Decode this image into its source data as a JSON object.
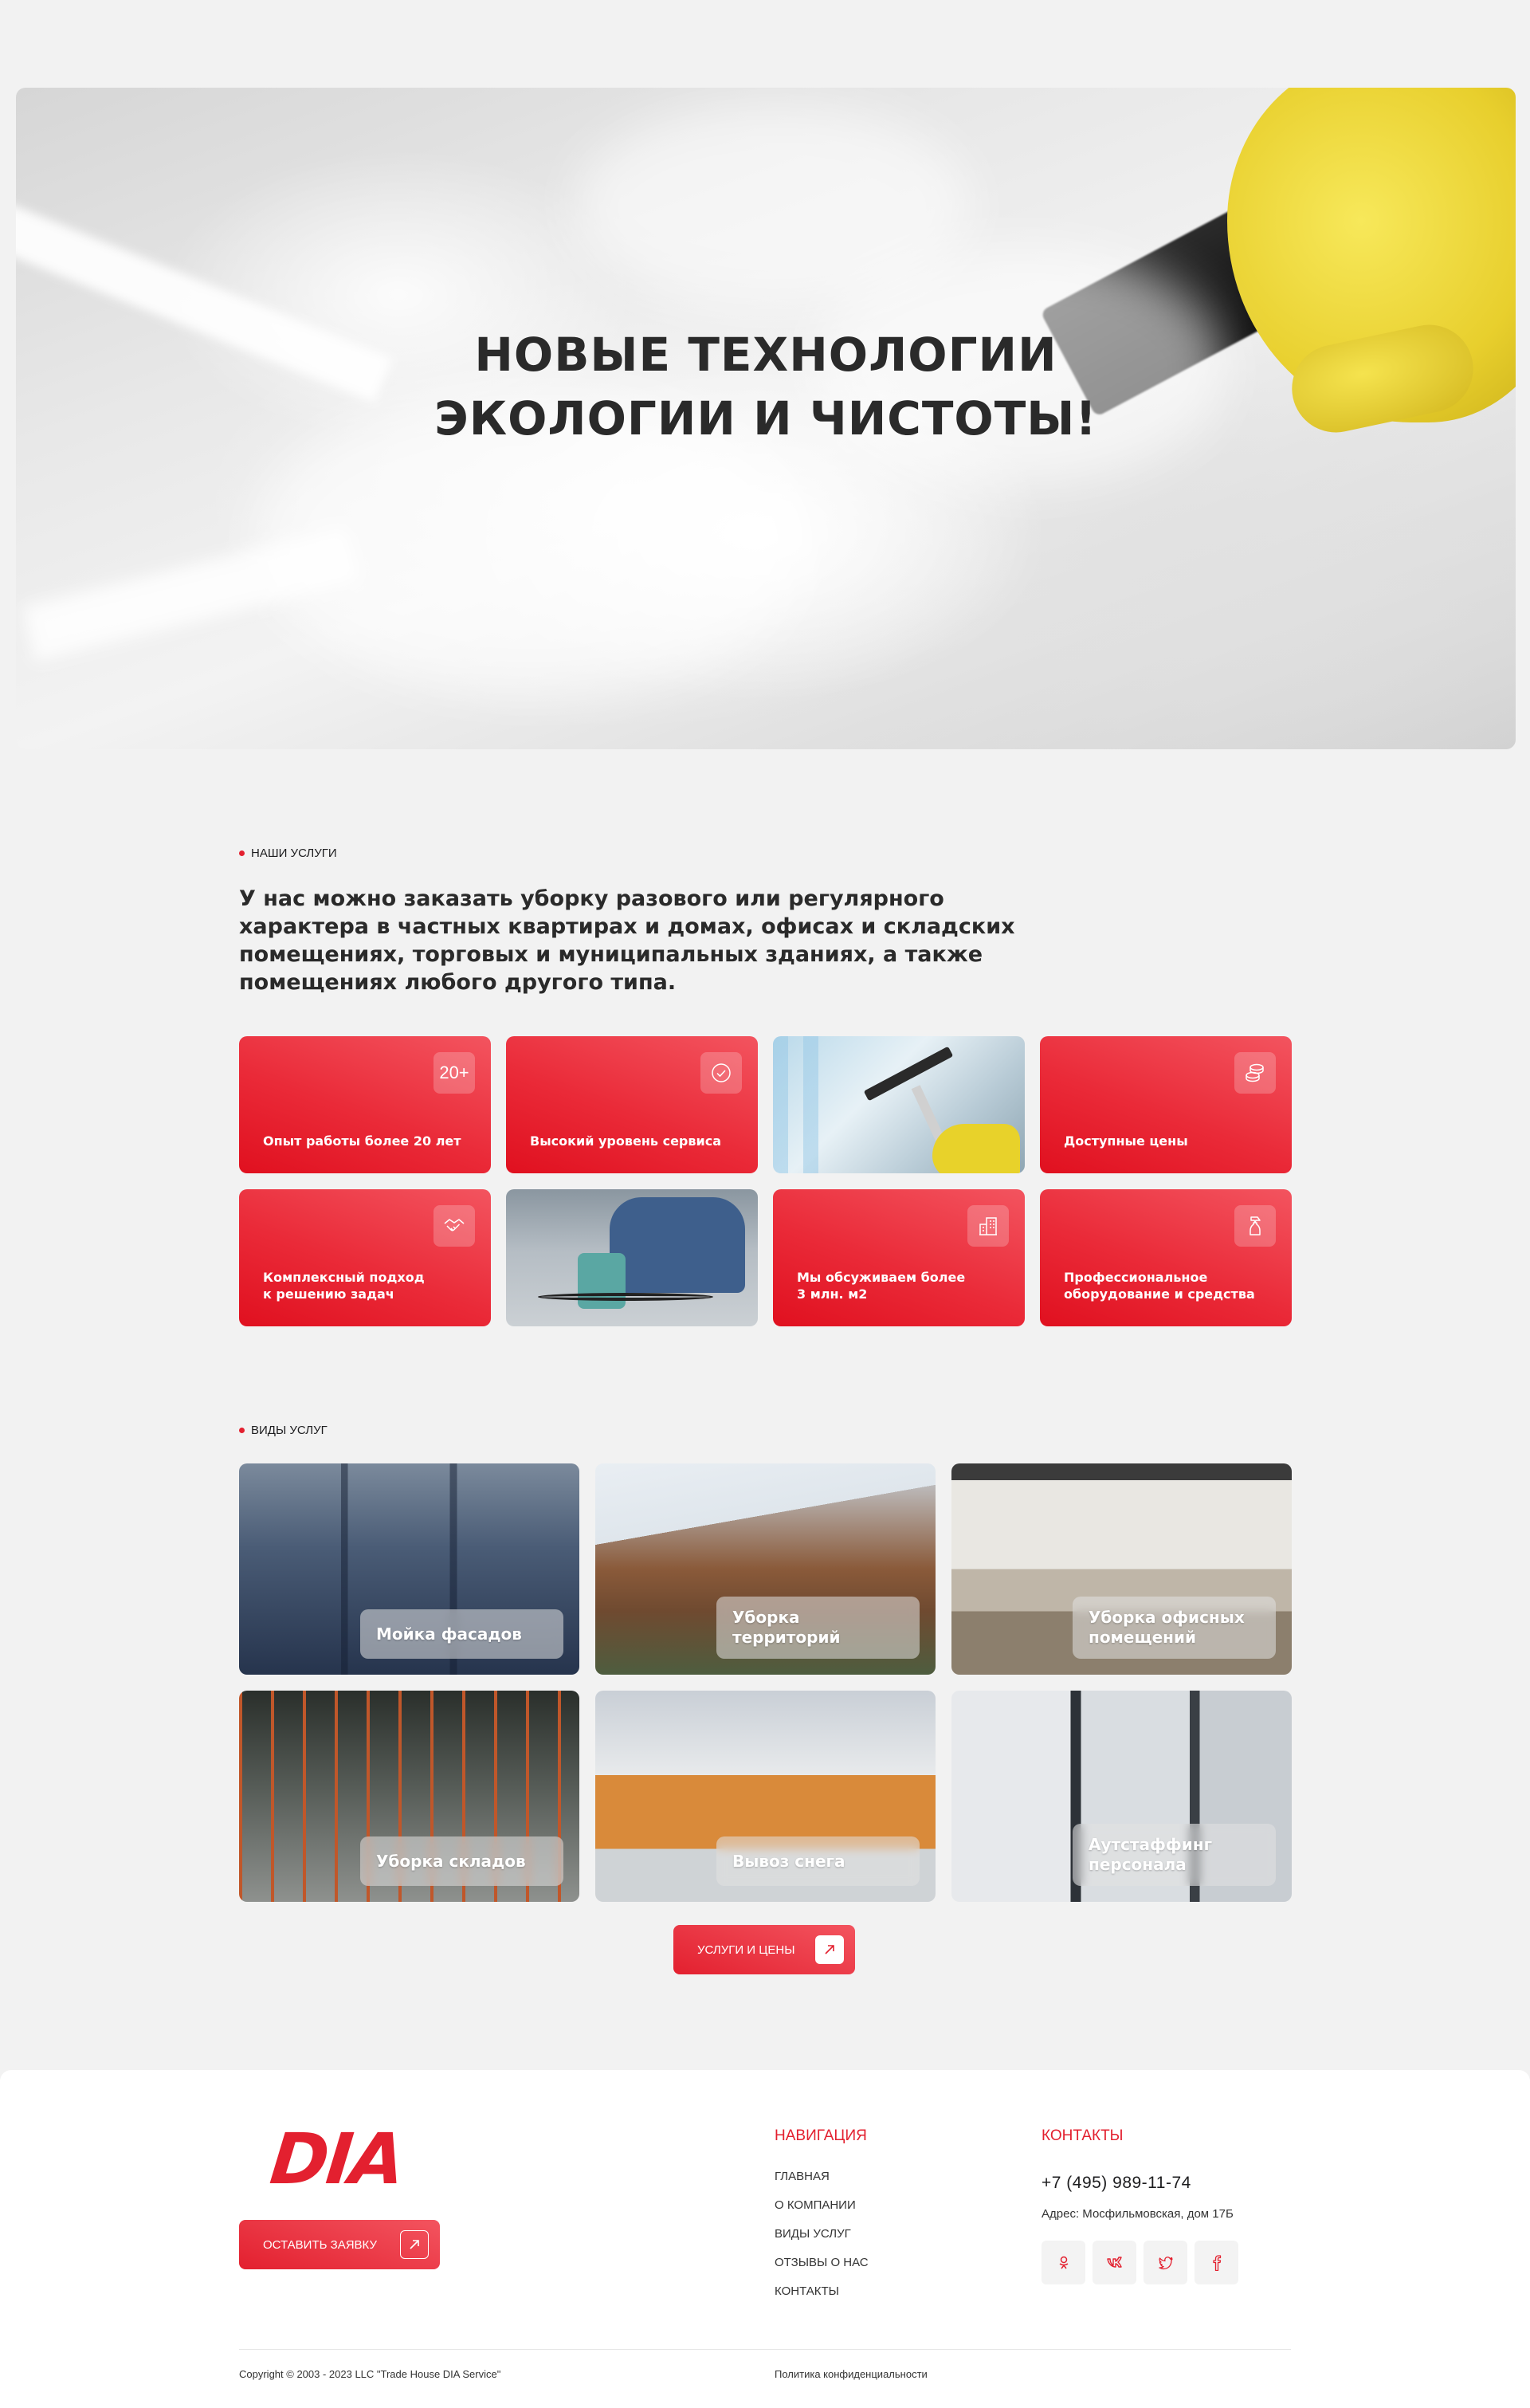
{
  "hero": {
    "title_line1": "НОВЫЕ ТЕХНОЛОГИИ",
    "title_line2": "ЭКОЛОГИИ И ЧИСТОТЫ!"
  },
  "services_intro": {
    "label": "НАШИ УСЛУГИ",
    "text": "У нас можно заказать уборку разового или регулярного характера в частных квартирах и домах, офисах и складских помещениях, торговых и муниципальных зданиях, а также помещениях любого другого типа."
  },
  "features": [
    {
      "text": "Опыт работы более 20 лет",
      "icon": "years-20-icon",
      "icon_text": "20+"
    },
    {
      "text": "Высокий уровень сервиса",
      "icon": "check-circle-icon"
    },
    {
      "text": "Доступные цены",
      "icon": "coins-icon"
    },
    {
      "text_line1": "Комплексный подход",
      "text_line2": "к решению задач",
      "icon": "handshake-icon"
    },
    {
      "text_line1": "Мы обсуживаем более",
      "text_line2": "3 млн. м2",
      "icon": "building-icon"
    },
    {
      "text_line1": "Профессиональное",
      "text_line2": "оборудование и средства",
      "icon": "spray-bottle-icon"
    }
  ],
  "service_types": {
    "label": "ВИДЫ УСЛУГ",
    "items": [
      {
        "line1": "Мойка фасадов",
        "line2": ""
      },
      {
        "line1": "Уборка",
        "line2": "территорий"
      },
      {
        "line1": "Уборка офисных",
        "line2": "помещений"
      },
      {
        "line1": "Уборка складов",
        "line2": ""
      },
      {
        "line1": "Вывоз снега",
        "line2": ""
      },
      {
        "line1": "Аутстаффинг",
        "line2": "персонала"
      }
    ],
    "button_label": "УСЛУГИ И ЦЕНЫ"
  },
  "footer": {
    "logo_text": "DIA",
    "cta_label": "ОСТАВИТЬ ЗАЯВКУ",
    "nav_title": "НАВИГАЦИЯ",
    "nav_items": [
      "ГЛАВНАЯ",
      "О КОМПАНИИ",
      "ВИДЫ УСЛУГ",
      "ОТЗЫВЫ О НАС",
      "КОНТАКТЫ"
    ],
    "contacts_title": "КОНТАКТЫ",
    "phone": "+7 (495) 989-11-74",
    "address": "Адрес:  Мосфильмовская, дом 17Б",
    "socials": [
      "odnoklassniki-icon",
      "vk-icon",
      "twitter-icon",
      "facebook-icon"
    ],
    "copyright": "Copyright © 2003 - 2023 LLC \"Trade House DIA Service\"",
    "privacy": "Политика конфиденциальности"
  },
  "colors": {
    "accent": "#e3202f",
    "background": "#f2f2f2"
  }
}
